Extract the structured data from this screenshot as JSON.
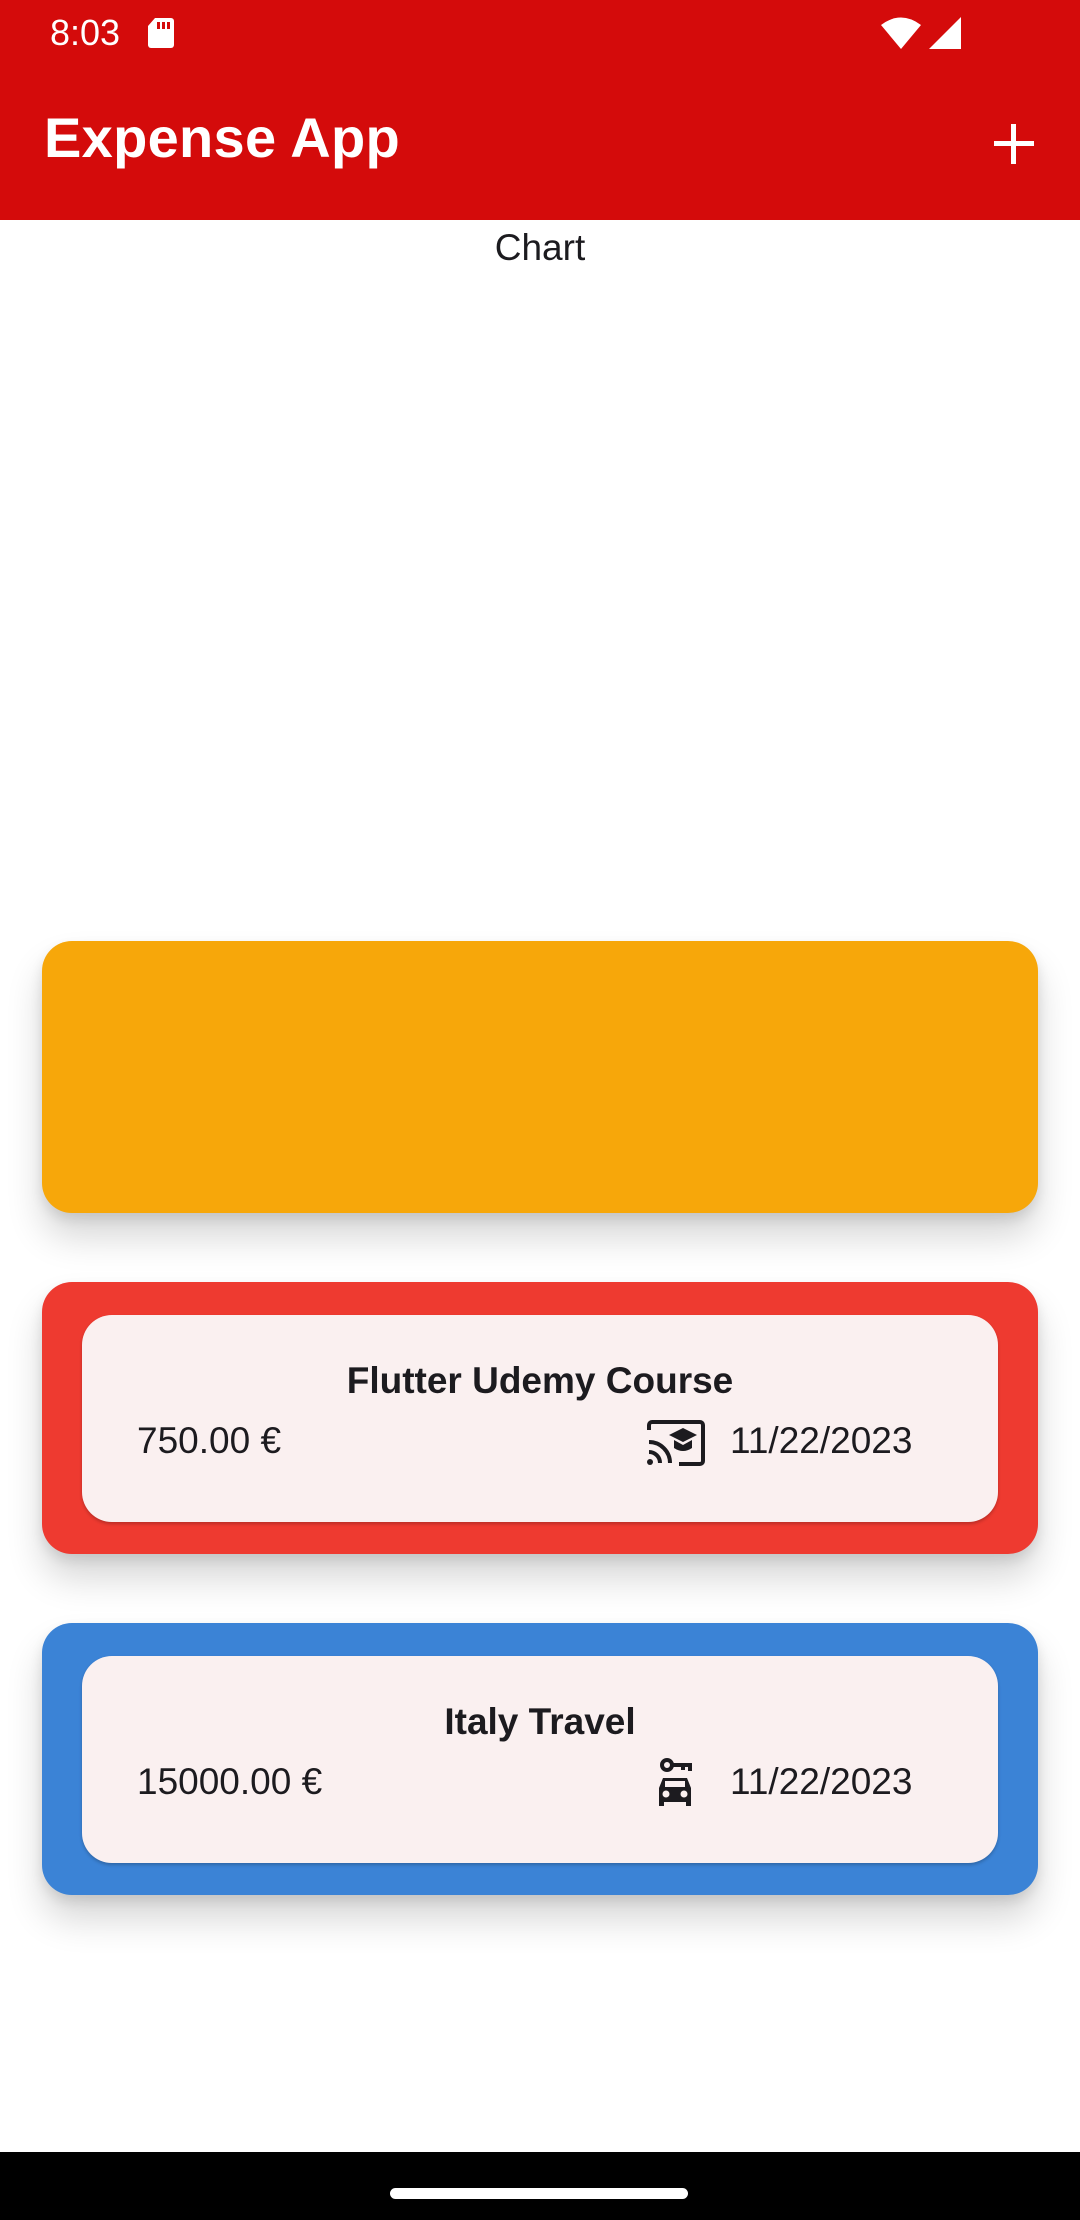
{
  "status_bar": {
    "time": "8:03",
    "icons": [
      "sd-card-icon",
      "wifi-icon",
      "cell-signal-icon"
    ]
  },
  "app_bar": {
    "title": "Expense App",
    "action_icon": "add-icon",
    "color": "#d40b0b"
  },
  "chart": {
    "label": "Chart"
  },
  "expenses": [
    {
      "title": "",
      "amount": "",
      "date": "",
      "category_icon": "",
      "color": "#f7a70a"
    },
    {
      "title": "Flutter Udemy Course",
      "amount": "750.00 €",
      "date": "11/22/2023",
      "category_icon": "cast-for-education-icon",
      "color": "#ee3a30"
    },
    {
      "title": "Italy Travel",
      "amount": "15000.00 €",
      "date": "11/22/2023",
      "category_icon": "car-rental-icon",
      "color": "#3b83d6"
    }
  ],
  "colors": {
    "card_surface": "#faf0f0",
    "text": "#1c1b1f"
  }
}
